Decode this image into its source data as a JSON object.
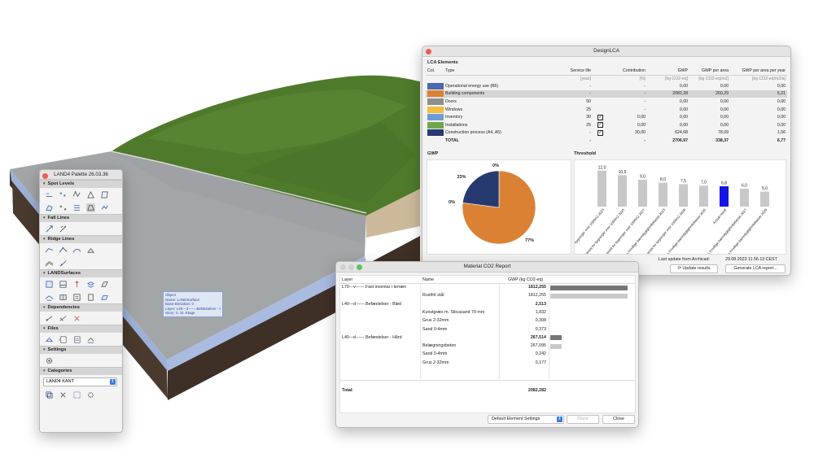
{
  "palette": {
    "title": "LAND4 Palette 26.03.36",
    "sections": [
      {
        "label": "Spot Levels"
      },
      {
        "label": "Fall Lines"
      },
      {
        "label": "Ridge Lines"
      },
      {
        "label": "LANDSurfaces"
      },
      {
        "label": "Dependencies"
      },
      {
        "label": "Files"
      },
      {
        "label": "Settings"
      },
      {
        "label": "Categories"
      }
    ],
    "category_value": "LAND4 KANT"
  },
  "tooltip": {
    "lines": [
      "Object",
      "Name: LANDSurface",
      "Base Elevation: 0",
      "Layer: L40---d------.Befæstelser - Hård",
      "Story: 0. St. Etage"
    ]
  },
  "lca": {
    "title": "DesignLCA",
    "section_title": "LCA Elements",
    "columns": {
      "col": "Col.",
      "type": "Type",
      "service_life": "Service life",
      "contribution": "Contribution",
      "gwp": "GWP",
      "gwp_area": "GWP per area",
      "gwp_area_year": "GWP per area per year"
    },
    "units": {
      "service_life": "[year]",
      "contribution": "[%]",
      "gwp": "[kg CO2-eq]",
      "gwp_area": "[kg CO2-eq/m2]",
      "gwp_area_year": "[kg CO2-eq/m2/a]"
    },
    "rows": [
      {
        "color": "#4b68ab",
        "type": "Operational energy use (B6)",
        "life": "-",
        "checked": false,
        "contribution": "-",
        "gwp": "0,00",
        "gwp_area": "0,00",
        "gwp_year": "0,00",
        "selected": false
      },
      {
        "color": "#db8134",
        "type": "Building components",
        "life": "-",
        "checked": false,
        "contribution": "-",
        "gwp": "2082,28",
        "gwp_area": "260,29",
        "gwp_year": "5,21",
        "selected": true
      },
      {
        "color": "#8f8f8f",
        "type": "Doors",
        "life": "50",
        "checked": false,
        "contribution": "-",
        "gwp": "0,00",
        "gwp_area": "0,00",
        "gwp_year": "0,00",
        "selected": false
      },
      {
        "color": "#f2be3c",
        "type": "Windows",
        "life": "25",
        "checked": false,
        "contribution": "-",
        "gwp": "0,00",
        "gwp_area": "0,00",
        "gwp_year": "0,00",
        "selected": false
      },
      {
        "color": "#6f9bd6",
        "type": "Inventory",
        "life": "30",
        "checked": true,
        "contribution": "0,00",
        "gwp": "0,00",
        "gwp_area": "0,00",
        "gwp_year": "0,00",
        "selected": false
      },
      {
        "color": "#6fa84a",
        "type": "Installations",
        "life": "25",
        "checked": true,
        "contribution": "0,00",
        "gwp": "0,00",
        "gwp_area": "0,00",
        "gwp_year": "0,00",
        "selected": false
      },
      {
        "color": "#263a70",
        "type": "Construction process (A4, A5)",
        "life": "-",
        "checked": true,
        "contribution": "30,00",
        "gwp": "624,68",
        "gwp_area": "78,09",
        "gwp_year": "1,56",
        "selected": false
      }
    ],
    "total": {
      "type": "TOTAL",
      "life": "-",
      "contribution": "-",
      "gwp": "2706,97",
      "gwp_area": "338,37",
      "gwp_year": "6,77"
    },
    "gwp_label": "GWP",
    "threshold_label": "Threshold",
    "footer": {
      "update_label": "Last update from Archicad:",
      "update_time": "29.08.2023 11.56.13 CEST",
      "update_button": "Update results",
      "generate_button": "Generate LCA report..."
    }
  },
  "chart_data": [
    {
      "type": "pie",
      "title": "GWP",
      "categories": [
        "Building components",
        "Construction process (A4, A5)",
        "Operational energy use (B6)",
        "Other"
      ],
      "values": [
        77,
        23,
        0,
        0
      ],
      "labels": [
        "77%",
        "23%",
        "0%",
        "0%"
      ],
      "colors": [
        "#db8134",
        "#263a70",
        "#4b68ab",
        "#8f8f8f"
      ]
    },
    {
      "type": "bar",
      "title": "Threshold",
      "categories": [
        "Bygningsreglementet for bygninger over 1000 m2 (2023)",
        "Bygningsreglementet for bygninger over 1000 m2 (2025)",
        "Bygningsreglementet for bygninger over 1000 m2 (2027)",
        "Den Frivillige bæredygtighedsklasse (2023)",
        "Bygningsreglementet for bygninger over 1000 m2 (2029)",
        "Den Frivillige bæredygtighedsklasse (2025)",
        "Actual result",
        "Den Frivillige bæredygtighedsklasse (2027)",
        "Den Frivillige bæredygtighedsklasse (2029)"
      ],
      "tick_labels": [
        "Bygningsreglementet for bygninger over 1000m2 2023",
        "Bygningsreglementet for bygninger over 1000m2 2025",
        "Bygningsreglementet for bygninger over 1000m2 2027",
        "Den Frivillige bæredygtighedsklasse 2023",
        "Bygningsreglementet for bygninger over 1000m2 2029",
        "Den Frivillige bæredygtighedsklasse 2025",
        "Actual result",
        "Den Frivillige bæredygtighedsklasse 2027",
        "Den Frivillige bæredygtighedsklasse 2029"
      ],
      "values": [
        12.0,
        10.5,
        9.0,
        8.0,
        7.5,
        7.0,
        6.8,
        6.0,
        5.0
      ],
      "value_labels": [
        "12,0",
        "10,5",
        "9,0",
        "8,0",
        "7,5",
        "7,0",
        "6,8",
        "6,0",
        "5,0"
      ],
      "highlight_index": 6,
      "bar_color": "#c8c8c8",
      "highlight_color": "#1414e6",
      "ylim": [
        0,
        12.5
      ]
    }
  ],
  "material": {
    "title": "Material CO2 Report",
    "headers": {
      "layer": "Layer",
      "name": "Name",
      "gwp": "GWP (kg CO2-eq)"
    },
    "rows": [
      {
        "layer": "L70---v------.Fast inventar i terræn",
        "name": "",
        "value": "1812,255",
        "bold": true,
        "bar": 1812.255,
        "dark": true
      },
      {
        "layer": "",
        "name": "Rustfrit stål",
        "value": "1812,255",
        "bold": false,
        "bar": 1812.255,
        "dark": false
      },
      {
        "layer": "L40---d------.Befæstelser - Blød",
        "name": "",
        "value": "2,513",
        "bold": true,
        "bar": 0,
        "dark": true
      },
      {
        "layer": "",
        "name": "Kunstgræs m. Silicasand 70 mm",
        "value": "1,832",
        "bold": false,
        "bar": 0,
        "dark": false
      },
      {
        "layer": "",
        "name": "Grus 2-32mm",
        "value": "0,308",
        "bold": false,
        "bar": 0,
        "dark": false
      },
      {
        "layer": "",
        "name": "Sand 0-4mm",
        "value": "0,373",
        "bold": false,
        "bar": 0,
        "dark": false
      },
      {
        "layer": "L40---d------.Befæstelser - Hård",
        "name": "",
        "value": "267,514",
        "bold": true,
        "bar": 267.514,
        "dark": true
      },
      {
        "layer": "",
        "name": "Belægningsbeton",
        "value": "267,095",
        "bold": false,
        "bar": 267.095,
        "dark": false
      },
      {
        "layer": "",
        "name": "Sand 0-4mm",
        "value": "0,242",
        "bold": false,
        "bar": 0,
        "dark": false
      },
      {
        "layer": "",
        "name": "Grus 2-32mm",
        "value": "0,177",
        "bold": false,
        "bar": 0,
        "dark": false
      }
    ],
    "total_label": "Total:",
    "total_value": "2082,282",
    "dropdown": "Default Element Settings",
    "place_button": "Place",
    "close_button": "Close"
  }
}
